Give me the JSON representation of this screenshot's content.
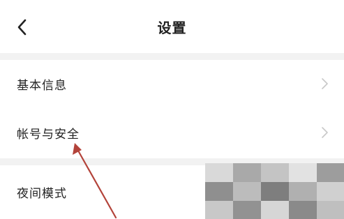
{
  "header": {
    "title": "设置",
    "back_icon": "chevron-left-icon"
  },
  "settings": {
    "items": [
      {
        "label": "基本信息",
        "icon": "chevron-right-icon"
      },
      {
        "label": "帐号与安全",
        "icon": "chevron-right-icon"
      },
      {
        "label": "夜间模式"
      }
    ]
  },
  "colors": {
    "background": "#ffffff",
    "section_gap": "#f2f2f2",
    "text": "#222222",
    "chevron": "#c8c8c8",
    "annotation_arrow": "#b3433a"
  }
}
